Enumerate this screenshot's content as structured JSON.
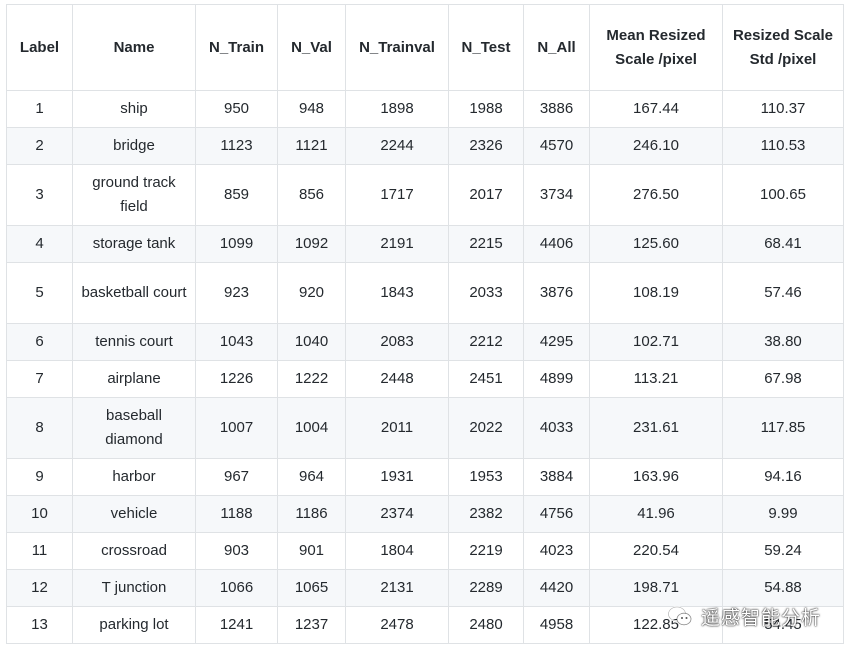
{
  "table": {
    "headers": [
      "Label",
      "Name",
      "N_Train",
      "N_Val",
      "N_Trainval",
      "N_Test",
      "N_All",
      "Mean Resized Scale /pixel",
      "Resized Scale Std /pixel"
    ],
    "rows": [
      [
        "1",
        "ship",
        "950",
        "948",
        "1898",
        "1988",
        "3886",
        "167.44",
        "110.37"
      ],
      [
        "2",
        "bridge",
        "1123",
        "1121",
        "2244",
        "2326",
        "4570",
        "246.10",
        "110.53"
      ],
      [
        "3",
        "ground track field",
        "859",
        "856",
        "1717",
        "2017",
        "3734",
        "276.50",
        "100.65"
      ],
      [
        "4",
        "storage tank",
        "1099",
        "1092",
        "2191",
        "2215",
        "4406",
        "125.60",
        "68.41"
      ],
      [
        "5",
        "basketball court",
        "923",
        "920",
        "1843",
        "2033",
        "3876",
        "108.19",
        "57.46"
      ],
      [
        "6",
        "tennis court",
        "1043",
        "1040",
        "2083",
        "2212",
        "4295",
        "102.71",
        "38.80"
      ],
      [
        "7",
        "airplane",
        "1226",
        "1222",
        "2448",
        "2451",
        "4899",
        "113.21",
        "67.98"
      ],
      [
        "8",
        "baseball diamond",
        "1007",
        "1004",
        "2011",
        "2022",
        "4033",
        "231.61",
        "117.85"
      ],
      [
        "9",
        "harbor",
        "967",
        "964",
        "1931",
        "1953",
        "3884",
        "163.96",
        "94.16"
      ],
      [
        "10",
        "vehicle",
        "1188",
        "1186",
        "2374",
        "2382",
        "4756",
        "41.96",
        "9.99"
      ],
      [
        "11",
        "crossroad",
        "903",
        "901",
        "1804",
        "2219",
        "4023",
        "220.54",
        "59.24"
      ],
      [
        "12",
        "T junction",
        "1066",
        "1065",
        "2131",
        "2289",
        "4420",
        "198.71",
        "54.88"
      ],
      [
        "13",
        "parking lot",
        "1241",
        "1237",
        "2478",
        "2480",
        "4958",
        "122.85",
        "54.45"
      ]
    ]
  },
  "watermark": {
    "text": "遥感智能分析",
    "icon": "wechat-icon"
  }
}
